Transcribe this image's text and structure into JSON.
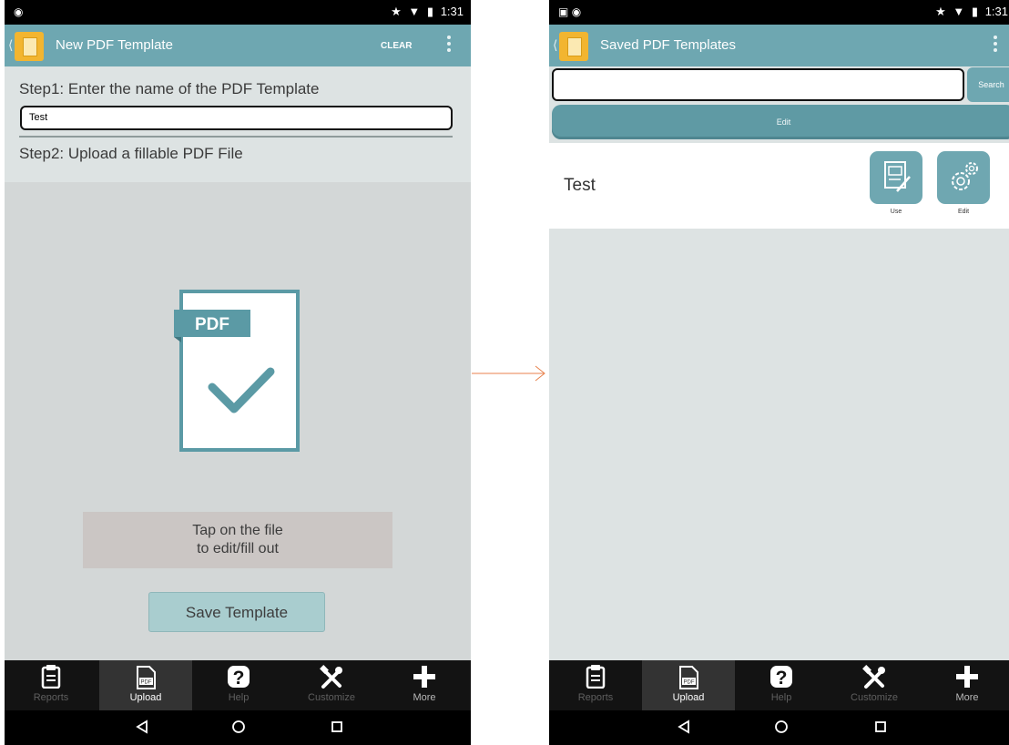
{
  "left_screen": {
    "title": "New PDF Template",
    "clear_label": "CLEAR",
    "time": "1:31",
    "step1": "Step1: Enter the name of the PDF Template",
    "name_value": "Test",
    "step2": "Step2: Upload a fillable PDF File",
    "pdf_badge": "PDF",
    "hint_line1": "Tap on the file",
    "hint_line2": "to edit/fill out",
    "save_label": "Save Template"
  },
  "right_screen": {
    "title": "Saved PDF Templates",
    "time": "1:31",
    "search_label": "Search",
    "search_value": "",
    "edit_bar_label": "Edit",
    "templates": [
      {
        "name": "Test",
        "use_label": "Use",
        "edit_label": "Edit"
      }
    ]
  },
  "nav": {
    "items": [
      "Reports",
      "Upload",
      "Help",
      "Customize",
      "More"
    ],
    "active": "Upload",
    "upload_badge": "PDF"
  },
  "colors": {
    "actionbar": "#6ea7b1",
    "background": "#dde3e3",
    "hint_box": "#cbc6c4",
    "save_button": "#a9cdcf",
    "edit_bar": "#5f9aa4"
  }
}
